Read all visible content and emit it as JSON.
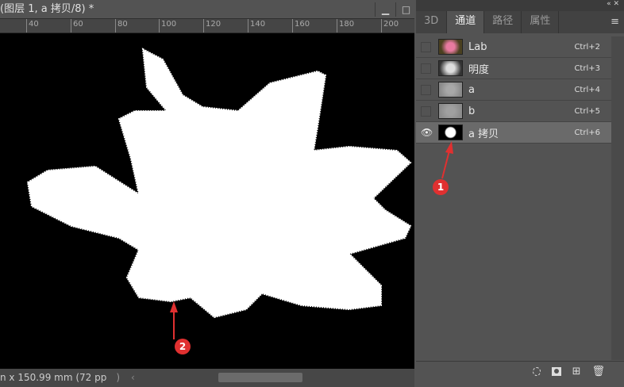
{
  "document": {
    "title": "(图层 1, a 拷贝/8) *",
    "ruler_ticks": [
      "40",
      "60",
      "80",
      "100",
      "120",
      "140",
      "160",
      "180",
      "200"
    ],
    "status": "n x 150.99 mm (72 pp"
  },
  "panel": {
    "tabs": [
      {
        "label": "3D"
      },
      {
        "label": "通道"
      },
      {
        "label": "路径"
      },
      {
        "label": "属性"
      }
    ],
    "channels": [
      {
        "name": "Lab",
        "shortcut": "Ctrl+2",
        "visible": false,
        "selected": false
      },
      {
        "name": "明度",
        "shortcut": "Ctrl+3",
        "visible": false,
        "selected": false
      },
      {
        "name": "a",
        "shortcut": "Ctrl+4",
        "visible": false,
        "selected": false
      },
      {
        "name": "b",
        "shortcut": "Ctrl+5",
        "visible": false,
        "selected": false
      },
      {
        "name": "a 拷贝",
        "shortcut": "Ctrl+6",
        "visible": true,
        "selected": true
      }
    ]
  },
  "annotations": {
    "first": "1",
    "second": "2",
    "color": "#e03030"
  }
}
